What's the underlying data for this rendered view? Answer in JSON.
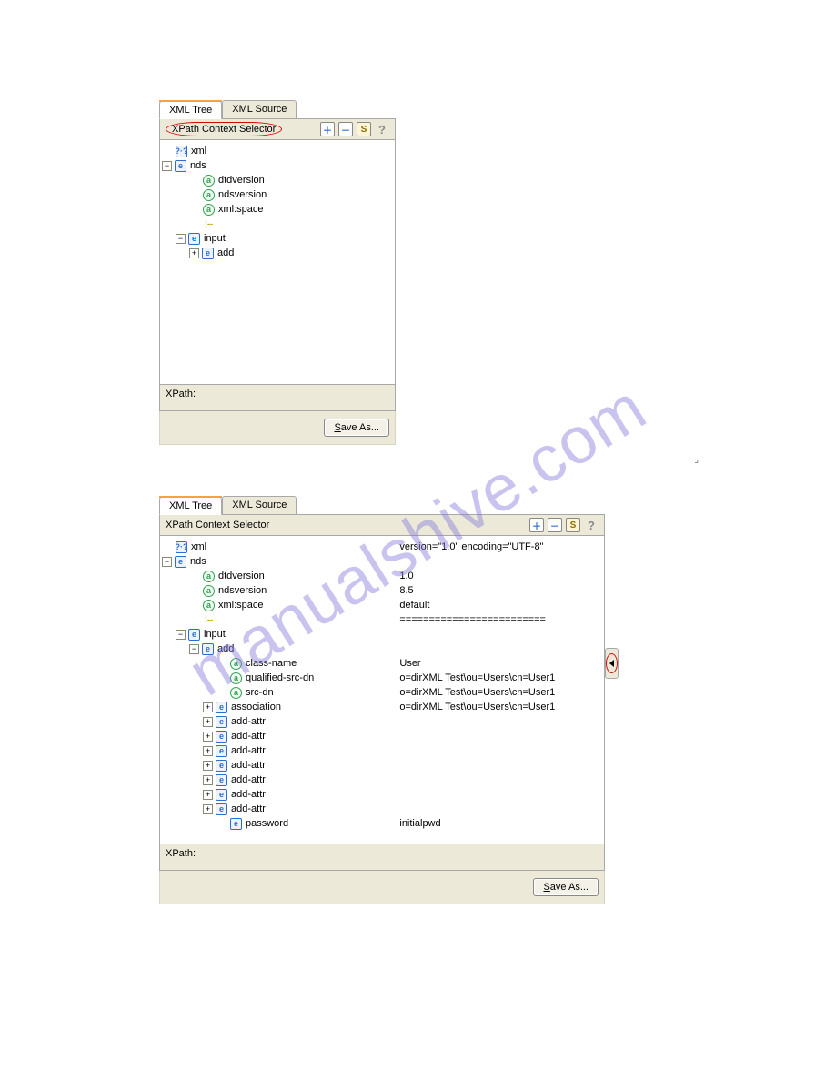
{
  "watermark": "manualshive.com",
  "panel1": {
    "tabs": {
      "tree": "XML Tree",
      "source": "XML Source",
      "active": "tree"
    },
    "selectorLabel": "XPath Context Selector",
    "ringed": true,
    "toolbar": {
      "s": "S"
    },
    "xpathLabel": "XPath:",
    "saveLabel": "Save As...",
    "tree": [
      {
        "depth": 0,
        "exp": "",
        "type": "q",
        "badge": "?·?",
        "label": "xml"
      },
      {
        "depth": 0,
        "exp": "−",
        "type": "e",
        "badge": "e",
        "label": "nds"
      },
      {
        "depth": 2,
        "exp": "",
        "type": "a",
        "badge": "a",
        "label": "dtdversion"
      },
      {
        "depth": 2,
        "exp": "",
        "type": "a",
        "badge": "a",
        "label": "ndsversion"
      },
      {
        "depth": 2,
        "exp": "",
        "type": "a",
        "badge": "a",
        "label": "xml:space"
      },
      {
        "depth": 2,
        "exp": "",
        "type": "c",
        "badge": "!--",
        "label": ""
      },
      {
        "depth": 1,
        "exp": "−",
        "type": "e",
        "badge": "e",
        "label": "input"
      },
      {
        "depth": 2,
        "exp": "+",
        "type": "e",
        "badge": "e",
        "label": "add"
      }
    ]
  },
  "panel2": {
    "tabs": {
      "tree": "XML Tree",
      "source": "XML Source",
      "active": "tree"
    },
    "selectorLabel": "XPath Context Selector",
    "ringed": false,
    "toolbar": {
      "s": "S"
    },
    "xpathLabel": "XPath:",
    "saveLabel": "Save As...",
    "tree": [
      {
        "depth": 0,
        "exp": "",
        "type": "q",
        "badge": "?·?",
        "label": "xml",
        "value": "version=\"1.0\" encoding=\"UTF-8\""
      },
      {
        "depth": 0,
        "exp": "−",
        "type": "e",
        "badge": "e",
        "label": "nds"
      },
      {
        "depth": 2,
        "exp": "",
        "type": "a",
        "badge": "a",
        "label": "dtdversion",
        "value": "1.0"
      },
      {
        "depth": 2,
        "exp": "",
        "type": "a",
        "badge": "a",
        "label": "ndsversion",
        "value": "8.5"
      },
      {
        "depth": 2,
        "exp": "",
        "type": "a",
        "badge": "a",
        "label": "xml:space",
        "value": "default"
      },
      {
        "depth": 2,
        "exp": "",
        "type": "c",
        "badge": "!--",
        "label": "",
        "value": "========================="
      },
      {
        "depth": 1,
        "exp": "−",
        "type": "e",
        "badge": "e",
        "label": "input"
      },
      {
        "depth": 2,
        "exp": "−",
        "type": "e",
        "badge": "e",
        "label": "add"
      },
      {
        "depth": 4,
        "exp": "",
        "type": "a",
        "badge": "a",
        "label": "class-name",
        "value": "User"
      },
      {
        "depth": 4,
        "exp": "",
        "type": "a",
        "badge": "a",
        "label": "qualified-src-dn",
        "value": "o=dirXML Test\\ou=Users\\cn=User1"
      },
      {
        "depth": 4,
        "exp": "",
        "type": "a",
        "badge": "a",
        "label": "src-dn",
        "value": "o=dirXML Test\\ou=Users\\cn=User1"
      },
      {
        "depth": 3,
        "exp": "+",
        "type": "e",
        "badge": "e",
        "label": "association",
        "value": "o=dirXML Test\\ou=Users\\cn=User1"
      },
      {
        "depth": 3,
        "exp": "+",
        "type": "e",
        "badge": "e",
        "label": "add-attr"
      },
      {
        "depth": 3,
        "exp": "+",
        "type": "e",
        "badge": "e",
        "label": "add-attr"
      },
      {
        "depth": 3,
        "exp": "+",
        "type": "e",
        "badge": "e",
        "label": "add-attr"
      },
      {
        "depth": 3,
        "exp": "+",
        "type": "e",
        "badge": "e",
        "label": "add-attr"
      },
      {
        "depth": 3,
        "exp": "+",
        "type": "e",
        "badge": "e",
        "label": "add-attr"
      },
      {
        "depth": 3,
        "exp": "+",
        "type": "e",
        "badge": "e",
        "label": "add-attr"
      },
      {
        "depth": 3,
        "exp": "+",
        "type": "e",
        "badge": "e",
        "label": "add-attr"
      },
      {
        "depth": 4,
        "exp": "",
        "type": "e",
        "badge": "e",
        "label": "password",
        "value": "initialpwd"
      }
    ]
  }
}
